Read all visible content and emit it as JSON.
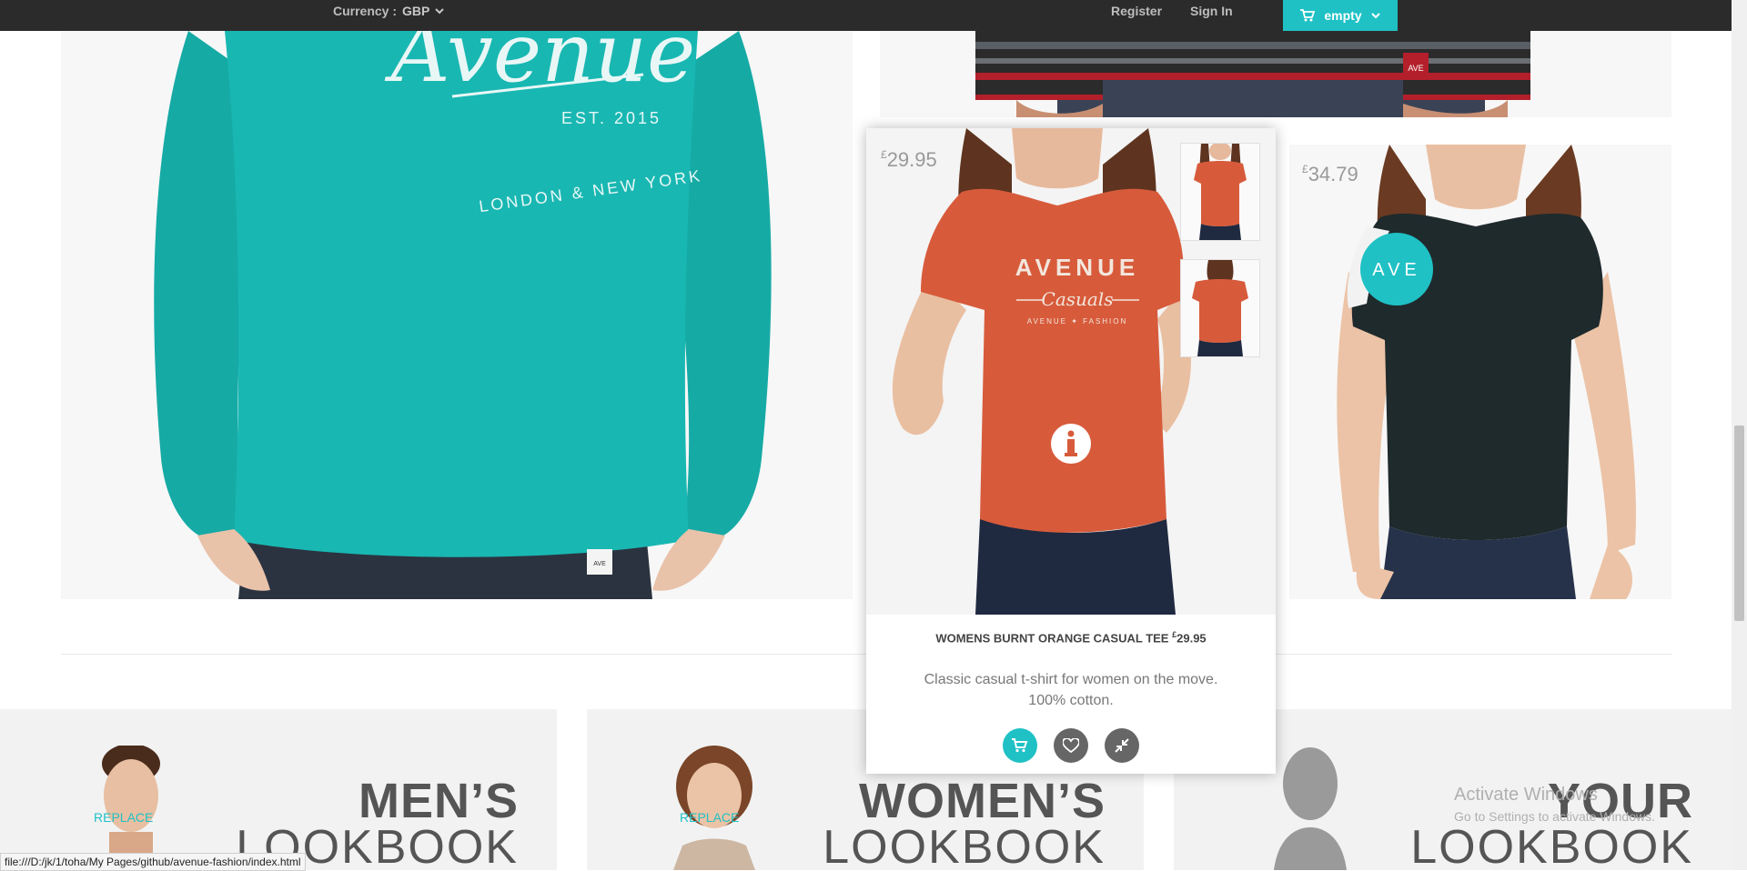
{
  "topbar": {
    "currency_label": "Currency :",
    "currency_value": "GBP",
    "register": "Register",
    "sign_in": "Sign In",
    "cart_label": "empty"
  },
  "products": {
    "left_tee_text": {
      "brand": "Avenue",
      "est": "EST. 2015",
      "cities": "LONDON & NEW YORK",
      "tag": "AVE"
    },
    "top_right_tag": "AVE",
    "right_tee": {
      "price_currency": "£",
      "price": "34.79",
      "badge": "AVE"
    }
  },
  "popup": {
    "price_currency": "£",
    "price": "29.95",
    "shirt_line1": "AVENUE",
    "shirt_line2": "Casuals",
    "shirt_line3": "AVENUE ✦ FASHION",
    "name": "WOMENS BURNT ORANGE CASUAL TEE",
    "name_price_currency": "£",
    "name_price": "29.95",
    "desc_line1": "Classic casual t-shirt for women on the move.",
    "desc_line2": "100% cotton.",
    "actions": [
      "cart-icon",
      "heart-icon",
      "compress-icon"
    ]
  },
  "lookbooks": [
    {
      "title": "MEN’S",
      "subtitle": "LOOKBOOK",
      "replace": "REPLACE"
    },
    {
      "title": "WOMEN’S",
      "subtitle": "LOOKBOOK",
      "replace": "REPLACE"
    },
    {
      "title": "YOUR",
      "subtitle": "LOOKBOOK"
    }
  ],
  "status_url": "file:///D:/jk/1/toha/My Pages/github/avenue-fashion/index.html",
  "watermark": {
    "line1": "Activate Windows",
    "line2": "Go to Settings to activate Windows."
  },
  "colors": {
    "accent": "#1fc1c5",
    "topbar": "#2b2b2b",
    "teal_tee": "#17b3ae",
    "orange_tee": "#d65a3a",
    "dark_tee": "#1e2a2e"
  }
}
